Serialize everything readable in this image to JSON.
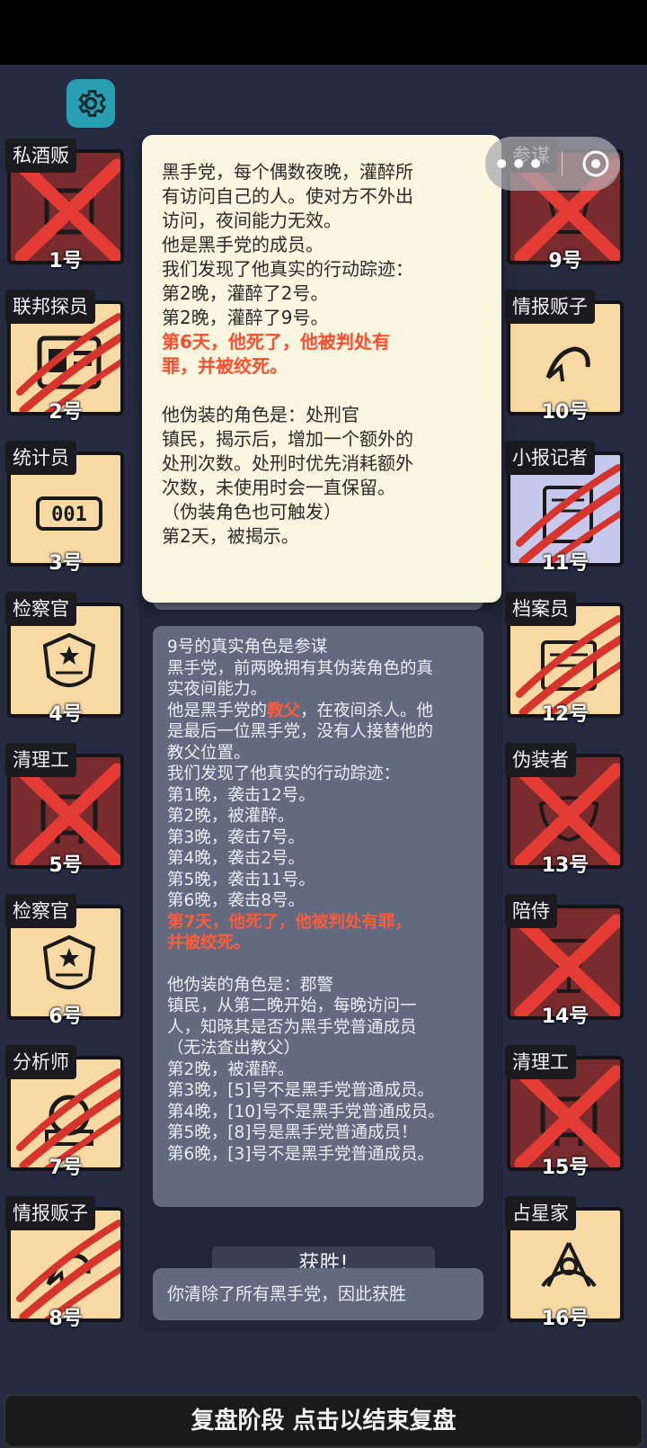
{
  "settings_icon": "gear-icon",
  "capsule": {
    "more": "•••",
    "close_icon": "target-circle-icon"
  },
  "left_cards": [
    {
      "role": "私酒贩",
      "num": "1号",
      "state": "dead",
      "icon": "bootlegger-icon"
    },
    {
      "role": "联邦探员",
      "num": "2号",
      "state": "clawed",
      "icon": "badge-id-icon"
    },
    {
      "role": "统计员",
      "num": "3号",
      "state": "alive",
      "icon": "counter-icon"
    },
    {
      "role": "检察官",
      "num": "4号",
      "state": "alive",
      "icon": "justice-emblem-icon"
    },
    {
      "role": "清理工",
      "num": "5号",
      "state": "dead",
      "icon": "cleaner-icon"
    },
    {
      "role": "检察官",
      "num": "6号",
      "state": "alive",
      "icon": "justice-emblem-icon"
    },
    {
      "role": "分析师",
      "num": "7号",
      "state": "clawed",
      "icon": "analyst-icon"
    },
    {
      "role": "情报贩子",
      "num": "8号",
      "state": "clawed",
      "icon": "whisper-icon"
    }
  ],
  "right_cards": [
    {
      "role": "参谋",
      "num": "9号",
      "state": "dead",
      "icon": "strategist-icon"
    },
    {
      "role": "情报贩子",
      "num": "10号",
      "state": "alive",
      "icon": "whisper-icon"
    },
    {
      "role": "小报记者",
      "num": "11号",
      "state": "clawed-cool",
      "icon": "newspaper-icon"
    },
    {
      "role": "档案员",
      "num": "12号",
      "state": "clawed",
      "icon": "archive-icon"
    },
    {
      "role": "伪装者",
      "num": "13号",
      "state": "dead",
      "icon": "mask-icon"
    },
    {
      "role": "陪侍",
      "num": "14号",
      "state": "dead",
      "icon": "wine-glass-icon"
    },
    {
      "role": "清理工",
      "num": "15号",
      "state": "dead",
      "icon": "cleaner-icon"
    },
    {
      "role": "占星家",
      "num": "16号",
      "state": "alive",
      "icon": "sextant-icon"
    }
  ],
  "popup": {
    "lines": [
      "黑手党，每个偶数夜晚，灌醉所",
      "有访问自己的人。使对方不外出",
      "访问，夜间能力无效。",
      "他是黑手党的成员。",
      "我们发现了他真实的行动踪迹：",
      "第2晚，灌醉了2号。",
      "第2晚，灌醉了9号。"
    ],
    "red_lines": [
      "第6天，他死了，他被判处有",
      "罪，并被绞死。"
    ],
    "lines2": [
      "他伪装的角色是：处刑官",
      "镇民，揭示后，增加一个额外的",
      "处刑次数。处刑时优先消耗额外",
      "次数，未使用时会一直保留。",
      "（伪装角色也可触发）",
      "第2天，被揭示。"
    ]
  },
  "bubble9": {
    "lines_a": [
      "9号的真实角色是参谋",
      "黑手党，前两晚拥有其伪装角色的真",
      "实夜间能力。"
    ],
    "godfather_prefix": "他是黑手党的",
    "godfather_word": "教父",
    "godfather_suffix": "，在夜间杀人。他",
    "lines_b": [
      "是最后一位黑手党，没有人接替他的",
      "教父位置。",
      "我们发现了他真实的行动踪迹：",
      "第1晚，袭击12号。",
      "第2晚，被灌醉。",
      "第3晚，袭击7号。",
      "第4晚，袭击2号。",
      "第5晚，袭击11号。",
      "第6晚，袭击8号。"
    ],
    "red_lines": [
      "第7天，他死了，他被判处有罪，",
      "并被绞死。"
    ],
    "lines_c": [
      "他伪装的角色是：郡警",
      "镇民，从第二晚开始，每晚访问一",
      "人，知晓其是否为黑手党普通成员",
      "（无法查出教父）",
      "第2晚，被灌醉。",
      "第3晚，[5]号不是黑手党普通成员。",
      "第4晚，[10]号不是黑手党普通成员。",
      "第5晚，[8]号是黑手党普通成员！",
      "第6晚，[3]号不是黑手党普通成员。"
    ]
  },
  "victory_label": "获胜!",
  "victory_message": "你清除了所有黑手党，因此获胜",
  "bottom_bar": "复盘阶段 点击以结束复盘",
  "colors": {
    "accent_red": "#ff5a3a",
    "card_bg": "#f7d9a3",
    "dead_bg": "#7a2b2d",
    "gear_bg": "#2a9fb3"
  }
}
